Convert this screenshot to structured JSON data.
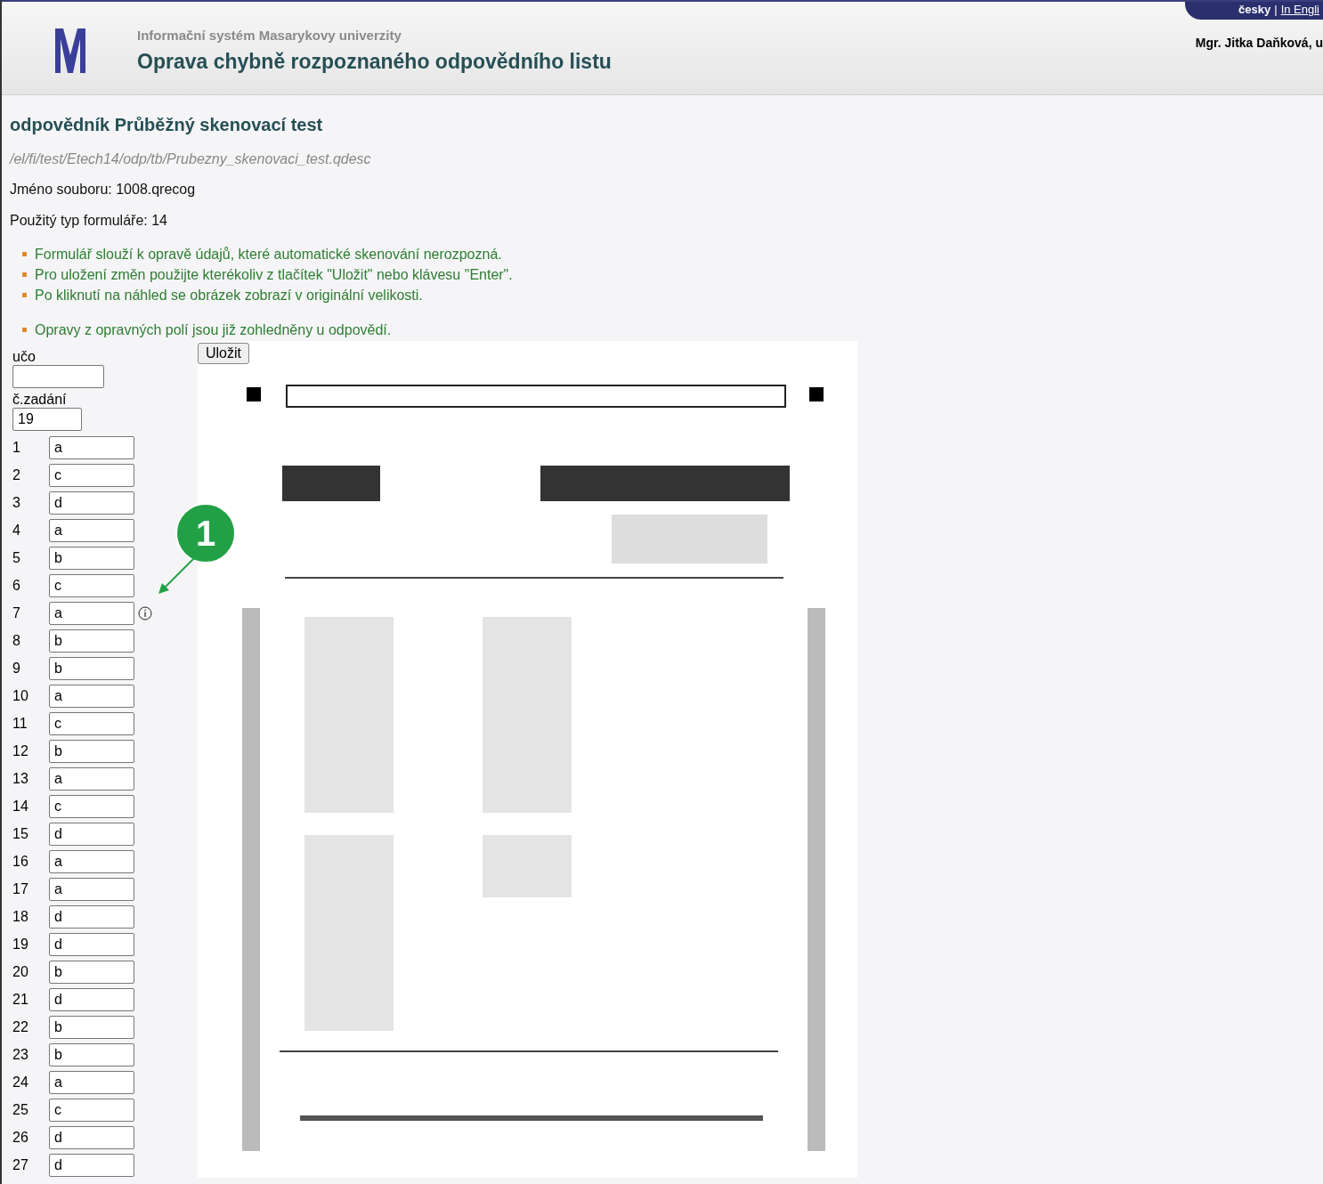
{
  "header": {
    "system_name": "Informační systém Masarykovy univerzity",
    "title": "Oprava chybně rozpoznaného odpovědního listu",
    "languages": [
      {
        "label": "česky",
        "selected": true
      },
      {
        "label": "In Engli",
        "selected": false
      }
    ],
    "language_separator": "|",
    "user": "Mgr. Jitka Daňková, u"
  },
  "page": {
    "heading": "odpovědník Průběžný skenovací test",
    "path": "/el/fi/test/Etech14/odp/tb/Prubezny_skenovaci_test.qdesc",
    "file_name": "Jméno souboru: 1008.qrecog",
    "form_type": "Použitý typ formuláře: 14"
  },
  "notes": [
    [
      "Formulář slouží k opravě údajů, které automatické skenování nerozpozná.",
      "Pro uložení změn použijte kterékoliv z tlačítek \"Uložit\" nebo klávesu \"Enter\".",
      "Po kliknutí na náhled se obrázek zobrazí v originální velikosti."
    ],
    [
      "Opravy z opravných polí jsou již zohledněny u odpovědí."
    ]
  ],
  "form": {
    "uco": {
      "label": "učo"
    },
    "assignment": {
      "label": "č.zadání",
      "value": "19"
    },
    "save_button": "Uložit",
    "answers": [
      {
        "number": "1",
        "value": "a",
        "info": false
      },
      {
        "number": "2",
        "value": "c",
        "info": false
      },
      {
        "number": "3",
        "value": "d",
        "info": false
      },
      {
        "number": "4",
        "value": "a",
        "info": false
      },
      {
        "number": "5",
        "value": "b",
        "info": false
      },
      {
        "number": "6",
        "value": "c",
        "info": false
      },
      {
        "number": "7",
        "value": "a",
        "info": true
      },
      {
        "number": "8",
        "value": "b",
        "info": false
      },
      {
        "number": "9",
        "value": "b",
        "info": false
      },
      {
        "number": "10",
        "value": "a",
        "info": false
      },
      {
        "number": "11",
        "value": "c",
        "info": false
      },
      {
        "number": "12",
        "value": "b",
        "info": false
      },
      {
        "number": "13",
        "value": "a",
        "info": false
      },
      {
        "number": "14",
        "value": "c",
        "info": false
      },
      {
        "number": "15",
        "value": "d",
        "info": false
      },
      {
        "number": "16",
        "value": "a",
        "info": false
      },
      {
        "number": "17",
        "value": "a",
        "info": false
      },
      {
        "number": "18",
        "value": "d",
        "info": false
      },
      {
        "number": "19",
        "value": "d",
        "info": false
      },
      {
        "number": "20",
        "value": "b",
        "info": false
      },
      {
        "number": "21",
        "value": "d",
        "info": false
      },
      {
        "number": "22",
        "value": "b",
        "info": false
      },
      {
        "number": "23",
        "value": "b",
        "info": false
      },
      {
        "number": "24",
        "value": "a",
        "info": false
      },
      {
        "number": "25",
        "value": "c",
        "info": false
      },
      {
        "number": "26",
        "value": "d",
        "info": false
      },
      {
        "number": "27",
        "value": "d",
        "info": false
      }
    ]
  },
  "callout": {
    "label": "1"
  },
  "scan": {
    "kind": "picture"
  }
}
